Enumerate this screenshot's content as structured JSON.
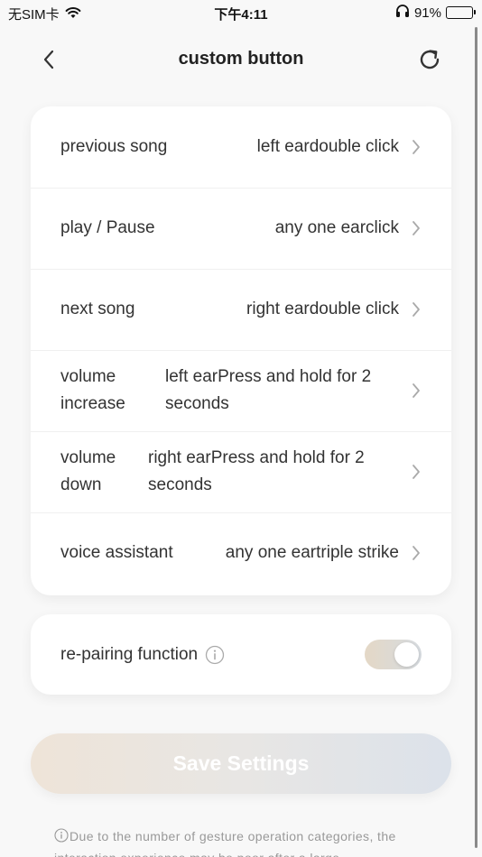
{
  "status_bar": {
    "carrier": "无SIM卡",
    "time": "下午4:11",
    "battery": "91%",
    "battery_level": 0.91
  },
  "nav": {
    "title": "custom button"
  },
  "actions": [
    {
      "label": "previous song",
      "value": "left eardouble click"
    },
    {
      "label": "play / Pause",
      "value": "any one earclick"
    },
    {
      "label": "next song",
      "value": "right eardouble click"
    },
    {
      "label": "volume increase",
      "value": "left earPress and hold for 2 seconds"
    },
    {
      "label": "volume down",
      "value": "right earPress and hold for 2 seconds"
    },
    {
      "label": "voice assistant",
      "value": "any one eartriple strike"
    }
  ],
  "repairing": {
    "label": "re-pairing function",
    "enabled": true
  },
  "save_button": "Save Settings",
  "notice": "Due to the number of gesture operation categories, the interaction experience may be poor after a large",
  "colors": {
    "background": "#f8f8f8",
    "card": "#ffffff",
    "save_gradient_start": "#eee4d8",
    "save_gradient_end": "#dce2ea"
  }
}
